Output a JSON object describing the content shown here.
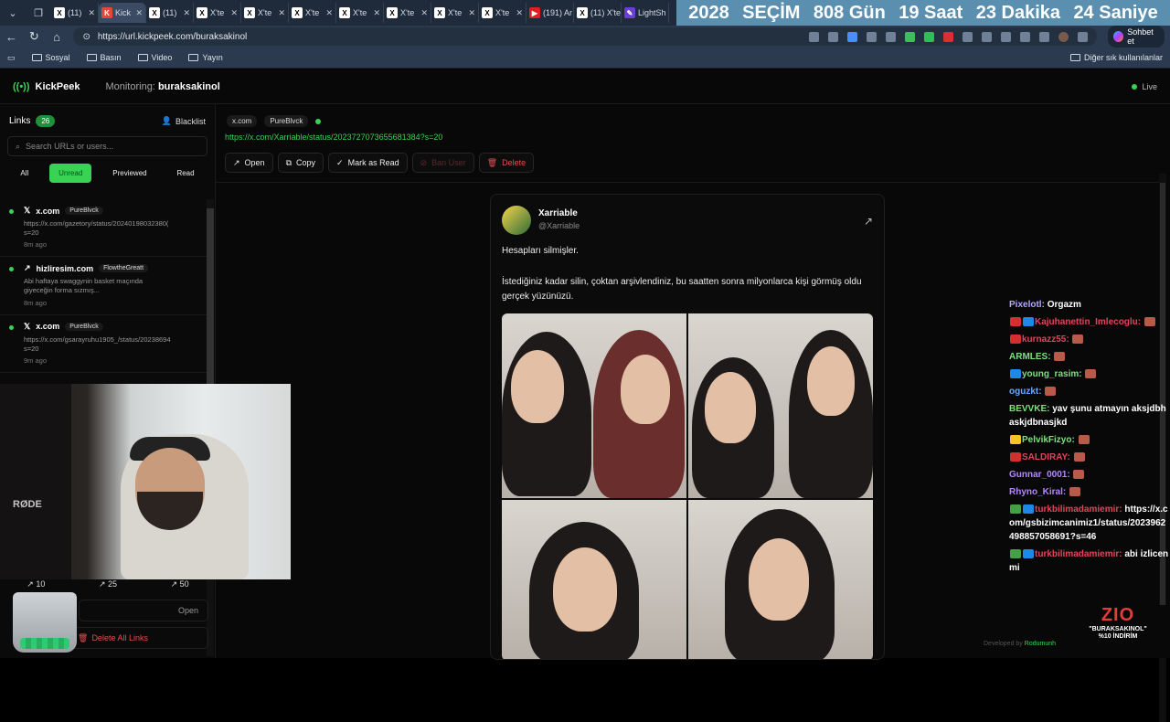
{
  "browser": {
    "tabs": [
      {
        "label": "(11)",
        "icon": "x-icon"
      },
      {
        "label": "Kick",
        "icon": "kick-icon",
        "active": true
      },
      {
        "label": "(11)",
        "icon": "x-icon"
      },
      {
        "label": "X'te",
        "icon": "x-icon"
      },
      {
        "label": "X'te",
        "icon": "x-icon"
      },
      {
        "label": "X'te",
        "icon": "x-icon"
      },
      {
        "label": "X'te",
        "icon": "x-icon"
      },
      {
        "label": "X'te",
        "icon": "x-icon"
      },
      {
        "label": "X'te",
        "icon": "x-icon"
      },
      {
        "label": "X'te",
        "icon": "x-icon"
      },
      {
        "label": "(191) Ar",
        "icon": "youtube-icon"
      },
      {
        "label": "(11) X'te",
        "icon": "x-icon"
      },
      {
        "label": "LightSh",
        "icon": "lightshot-icon"
      }
    ],
    "url": "https://url.kickpeek.com/buraksakinol",
    "sohbet_label": "Sohbet et",
    "bookmarks": [
      "Sosyal",
      "Basın",
      "Video",
      "Yayın"
    ],
    "bookmarks_other": "Diğer sık kullanılanlar"
  },
  "banner": {
    "year": "2028",
    "word": "SEÇİM",
    "days": "808 Gün",
    "hours": "19 Saat",
    "minutes": "23 Dakika",
    "seconds": "24 Saniye"
  },
  "app": {
    "brand": "KickPeek",
    "monitoring_label": "Monitoring:",
    "monitoring_user": "buraksakinol",
    "live_label": "Live"
  },
  "sidebar": {
    "links_label": "Links",
    "links_count": "26",
    "blacklist_label": "Blacklist",
    "search_placeholder": "Search URLs or users...",
    "filters": [
      "All",
      "Unread",
      "Previewed",
      "Read"
    ],
    "items": [
      {
        "domain": "x.com",
        "user": "PureBlvck",
        "url": "https://x.com/gazetory/status/20240198032380(\ns=20",
        "time": "8m ago"
      },
      {
        "domain": "hizliresim.com",
        "user": "FlowtheGreatt",
        "url": "Abi haftaya swaggynin basket maçında\ngiyeceğin forma sızmış...",
        "time": "8m ago"
      },
      {
        "domain": "x.com",
        "user": "PureBlvck",
        "url": "https://x.com/gsarayruhu1905_/status/20238694\ns=20",
        "time": "9m ago"
      }
    ],
    "counts": [
      "10",
      "25",
      "50"
    ],
    "open_label": "Open",
    "delete_all_label": "Delete All Links"
  },
  "main": {
    "tag_domain": "x.com",
    "tag_user": "PureBlvck",
    "url": "https://x.com/Xarriable/status/2023727073655681384?s=20",
    "actions": {
      "open": "Open",
      "copy": "Copy",
      "mark_read": "Mark as Read",
      "ban_user": "Ban User",
      "delete": "Delete"
    },
    "tweet": {
      "name": "Xarriable",
      "handle": "@Xarriable",
      "line1": "Hesapları silmişler.",
      "line2": "İstediğiniz kadar silin, çoktan arşivlendiniz, bu saatten sonra milyonlarca kişi görmüş oldu gerçek yüzünüzü."
    }
  },
  "chat": [
    {
      "user": "Pixelotl:",
      "color": "#b4a7ff",
      "msg": "Orgazm",
      "emotes": []
    },
    {
      "user": "Kajuhanettin_Imlecoglu:",
      "color": "#e0455a",
      "msg": "",
      "emotes": [
        "r",
        "b"
      ]
    },
    {
      "user": "kurnazz55:",
      "color": "#e0455a",
      "msg": "",
      "emotes": [
        "r"
      ]
    },
    {
      "user": "ARMLES:",
      "color": "#7be27b",
      "msg": "",
      "emotes": []
    },
    {
      "user": "young_rasim:",
      "color": "#7be27b",
      "msg": "",
      "emotes": [
        "b"
      ]
    },
    {
      "user": "oguzkt:",
      "color": "#6aa7ff",
      "msg": "",
      "emotes": []
    },
    {
      "user": "BEVVKE:",
      "color": "#7be27b",
      "msg": "yav şunu atmayın aksjdbhaskjdbnasjkd",
      "emotes": []
    },
    {
      "user": "PelvikFizyo:",
      "color": "#7be27b",
      "msg": "",
      "emotes": [
        "y"
      ]
    },
    {
      "user": "SALDIRAY:",
      "color": "#e0455a",
      "msg": "",
      "emotes": [
        "r"
      ]
    },
    {
      "user": "Gunnar_0001:",
      "color": "#b388ff",
      "msg": "",
      "emotes": []
    },
    {
      "user": "Rhyno_Kiral:",
      "color": "#b388ff",
      "msg": "",
      "emotes": []
    },
    {
      "user": "turkbilimadamiemir:",
      "color": "#e0455a",
      "msg": "https://x.com/gsbizimcanimiz1/status/2023962498857058691?s=46",
      "emotes": [
        "g",
        "b"
      ]
    },
    {
      "user": "turkbilimadamiemir:",
      "color": "#e0455a",
      "msg": "abi izlicen mi",
      "emotes": [
        "g",
        "b"
      ]
    }
  ],
  "footer": {
    "developed_by": "Developed by",
    "developer": "Rodumunh",
    "promo_logo": "ZIO",
    "promo_code": "\"BURAKSAKINOL\"",
    "promo_discount": "%10 İNDİRİM"
  }
}
